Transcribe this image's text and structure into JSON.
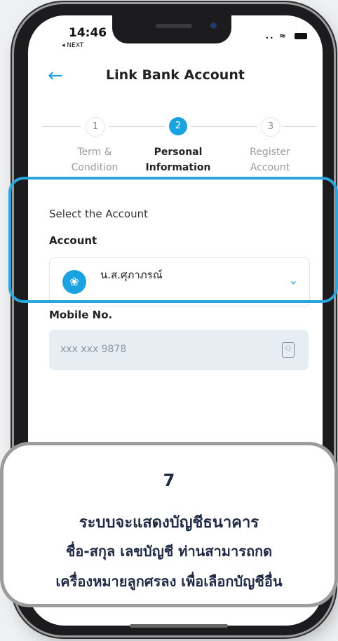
{
  "status_bar": {
    "time": "14:46",
    "back_app": "◂ NEXT",
    "signal": "..",
    "wifi": "≈"
  },
  "header": {
    "title": "Link Bank Account",
    "back_icon": "arrow-left-icon"
  },
  "stepper": {
    "steps": [
      {
        "number": "1",
        "label_line1": "Term &",
        "label_line2": "Condition",
        "state": "done"
      },
      {
        "number": "2",
        "label_line1": "Personal",
        "label_line2": "Information",
        "state": "active"
      },
      {
        "number": "3",
        "label_line1": "Register",
        "label_line2": "Account",
        "state": "pending"
      }
    ]
  },
  "account_section": {
    "section_title": "Select the Account",
    "account_label": "Account",
    "selected_account": "น.ส.ศุภาภรณ์",
    "bank_logo_icon": "bank-logo-icon",
    "chevron_icon": "chevron-down-icon"
  },
  "mobile": {
    "label": "Mobile No.",
    "value": "xxx xxx 9878",
    "contact_icon": "contacts-icon"
  },
  "callout": {
    "number": "7",
    "line1": "ระบบจะแสดงบัญชีธนาคาร",
    "line2": "ชื่อ-สกุล เลขบัญชี ท่านสามารถกด",
    "line3": "เครื่องหมายลูกศรลง เพื่อเลือกบัญชีอื่น"
  },
  "colors": {
    "accent": "#1aa3e0",
    "highlight": "#2aa5e0",
    "callout_border": "#9c9c9c"
  }
}
